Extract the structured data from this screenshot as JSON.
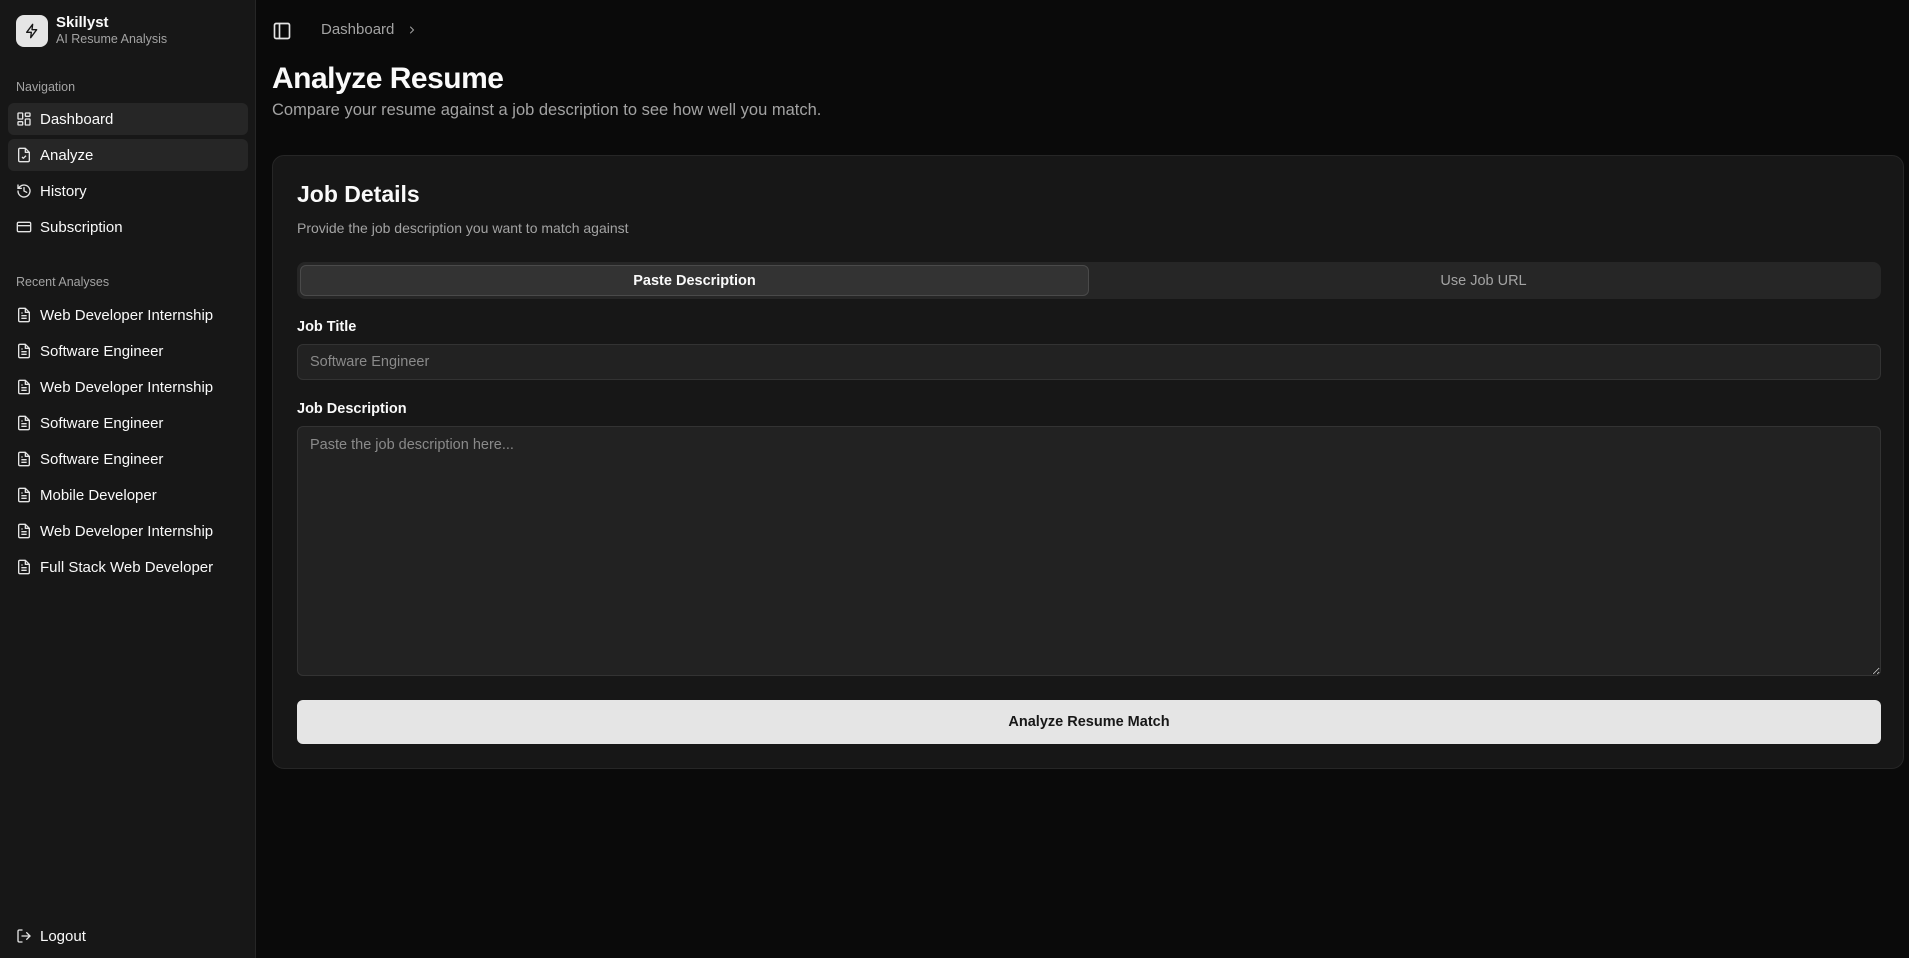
{
  "brand": {
    "name": "Skillyst",
    "tagline": "AI Resume Analysis",
    "icon": "lightning-icon"
  },
  "sidebar": {
    "nav_label": "Navigation",
    "nav_items": [
      {
        "label": "Dashboard",
        "icon": "grid-icon",
        "active": true
      },
      {
        "label": "Analyze",
        "icon": "file-check-icon",
        "active": true
      },
      {
        "label": "History",
        "icon": "history-icon",
        "active": false
      },
      {
        "label": "Subscription",
        "icon": "credit-card-icon",
        "active": false
      }
    ],
    "recent_label": "Recent Analyses",
    "recent_items": [
      "Web Developer Internship",
      "Software Engineer",
      "Web Developer Internship",
      "Software Engineer",
      "Software Engineer",
      "Mobile Developer",
      "Web Developer Internship",
      "Full Stack Web Developer"
    ],
    "logout_label": "Logout"
  },
  "header": {
    "breadcrumb": "Dashboard"
  },
  "page": {
    "title": "Analyze Resume",
    "subtitle": "Compare your resume against a job description to see how well you match."
  },
  "card": {
    "title": "Job Details",
    "description": "Provide the job description you want to match against",
    "tabs": [
      {
        "label": "Paste Description",
        "active": true
      },
      {
        "label": "Use Job URL",
        "active": false
      }
    ],
    "job_title_label": "Job Title",
    "job_title_placeholder": "Software Engineer",
    "job_description_label": "Job Description",
    "job_description_placeholder": "Paste the job description here...",
    "submit_label": "Analyze Resume Match"
  },
  "colors": {
    "background": "#0a0a0a",
    "sidebar": "#171717",
    "card": "#171717",
    "primary_button": "#e5e5e5"
  }
}
